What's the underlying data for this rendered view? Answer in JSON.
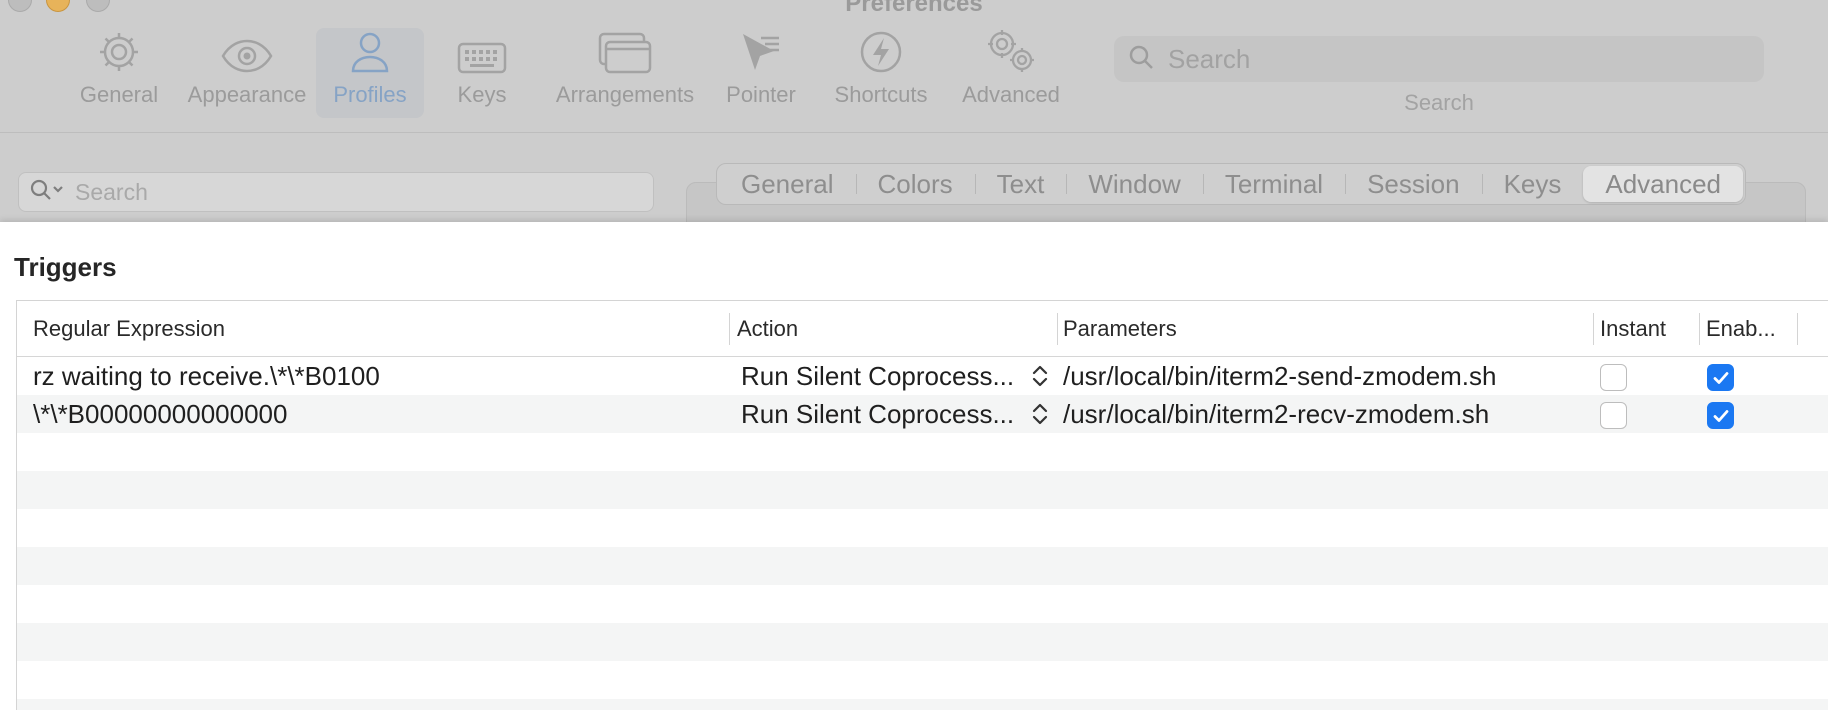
{
  "window": {
    "title": "Preferences"
  },
  "toolbar": {
    "items": [
      {
        "label": "General",
        "icon": "gear-icon"
      },
      {
        "label": "Appearance",
        "icon": "eye-icon"
      },
      {
        "label": "Profiles",
        "icon": "person-icon",
        "selected": true
      },
      {
        "label": "Keys",
        "icon": "keyboard-icon"
      },
      {
        "label": "Arrangements",
        "icon": "windows-icon"
      },
      {
        "label": "Pointer",
        "icon": "pointer-icon"
      },
      {
        "label": "Shortcuts",
        "icon": "bolt-icon"
      },
      {
        "label": "Advanced",
        "icon": "gears-icon"
      }
    ],
    "search_placeholder": "Search",
    "search_label": "Search"
  },
  "profile_search": {
    "placeholder": "Search"
  },
  "profile_tabs": [
    {
      "label": "General"
    },
    {
      "label": "Colors"
    },
    {
      "label": "Text"
    },
    {
      "label": "Window"
    },
    {
      "label": "Terminal"
    },
    {
      "label": "Session"
    },
    {
      "label": "Keys"
    },
    {
      "label": "Advanced",
      "selected": true
    }
  ],
  "triggers": {
    "title": "Triggers",
    "columns": {
      "regex": "Regular Expression",
      "action": "Action",
      "parameters": "Parameters",
      "instant": "Instant",
      "enabled": "Enab..."
    },
    "rows": [
      {
        "regex": "rz waiting to receive.\\*\\*B0100",
        "action": "Run Silent Coprocess...",
        "parameters": "/usr/local/bin/iterm2-send-zmodem.sh",
        "instant": false,
        "enabled": true
      },
      {
        "regex": "\\*\\*B00000000000000",
        "action": "Run Silent Coprocess...",
        "parameters": "/usr/local/bin/iterm2-recv-zmodem.sh",
        "instant": false,
        "enabled": true
      }
    ]
  },
  "colors": {
    "accent": "#1b78f2",
    "selected_toolbar_text": "#86a3c5"
  }
}
